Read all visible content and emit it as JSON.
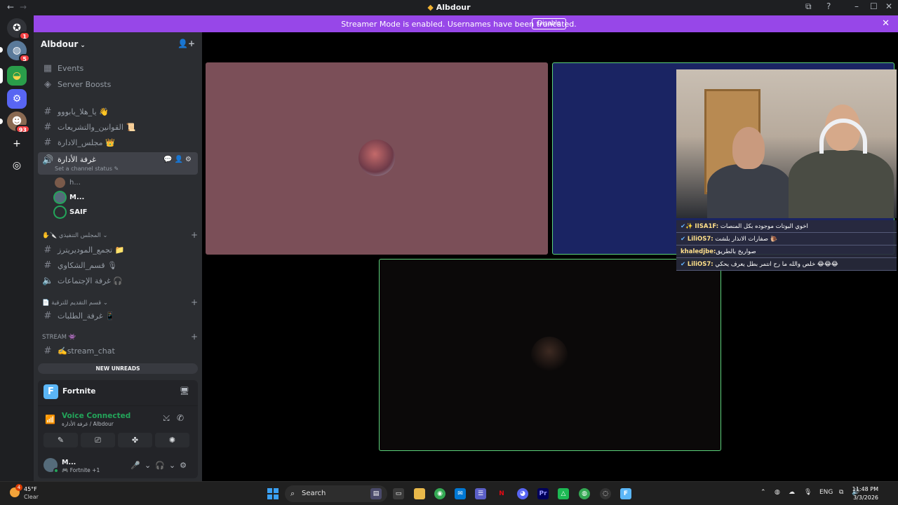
{
  "window": {
    "title": "Albdour",
    "back": "←",
    "forward": "→",
    "controls": [
      "⧉",
      "?",
      "–",
      "☐",
      "✕"
    ]
  },
  "banner": {
    "message": "Streamer Mode is enabled. Usernames have been truncated.",
    "disable_label": "Disable",
    "close": "✕"
  },
  "servers": [
    {
      "label": "✪",
      "badge": "1"
    },
    {
      "label": "◍",
      "badge": "5"
    },
    {
      "label": "◒",
      "badge": ""
    },
    {
      "label": "⚙",
      "badge": ""
    },
    {
      "label": "☻",
      "badge": "93"
    },
    {
      "label": "+",
      "badge": ""
    },
    {
      "label": "◎",
      "badge": ""
    }
  ],
  "guild": {
    "name": "Albdour",
    "events": "Events",
    "boosts": "Server Boosts"
  },
  "channels": {
    "c1": "يا_هلا_يابووو 👋",
    "c2": "القوانين_والتشريعات 📜",
    "c3": "مجلس_الادارة 👑",
    "voice_active": "غرفة الأدارة",
    "voice_status": "Set a channel status",
    "voice_users": [
      "h...",
      "M...",
      "SAIF"
    ],
    "cat1": "المجلس التنفيذي",
    "c4": "تجمع_الموديريترز 📁",
    "c5": "قسم_الشكاوي 🎙",
    "c6": "غرفة الإجتماعات 🎧",
    "cat2": "قسم التقديم للترقية",
    "c7": "غرفة_الطلبات 📱",
    "cat3": "Stream 👾",
    "c8": "✍️stream_chat",
    "new_unreads": "NEW UNREADS"
  },
  "activity": {
    "game": "Fortnite",
    "icon": "F"
  },
  "voice": {
    "status": "Voice Connected",
    "location": "غرفة الأدارة / Albdour",
    "buttons": [
      "⤩",
      "✆"
    ],
    "actions": [
      "✎",
      "⎚",
      "✤",
      "✺"
    ]
  },
  "user": {
    "name": "M...",
    "status": "🎮 Fortnite +1",
    "controls": [
      "🎤",
      "⌄",
      "🎧",
      "⌄",
      "⚙"
    ]
  },
  "chat": [
    {
      "user": "IISA1F:",
      "text": "اخوي البوتات موجوده بكل المنصات",
      "verified": "✔",
      "extra": "✨"
    },
    {
      "user": "LiliOS7:",
      "text": "صفارات الانذار بلشت 🐌",
      "verified": "✔",
      "extra": ""
    },
    {
      "user": "khaledjbe:",
      "text": "صواريخ بالطريق",
      "verified": "",
      "extra": ""
    },
    {
      "user": "LiliOS7:",
      "text": "خلص والله ما رح انتمر بطل يعرف يحكي 😂😂😂",
      "verified": "✔",
      "extra": ""
    }
  ],
  "taskbar": {
    "weather_temp": "45°F",
    "weather_cond": "Clear",
    "weather_badge": "4",
    "search": "Search",
    "lang": "ENG",
    "time": "11:48 PM",
    "date": "3/3/2026",
    "apps": [
      "▤",
      "▭",
      "◉",
      "✉",
      "☰",
      "N",
      "◕",
      "Pr",
      "△",
      "◍",
      "◌",
      "F"
    ]
  }
}
